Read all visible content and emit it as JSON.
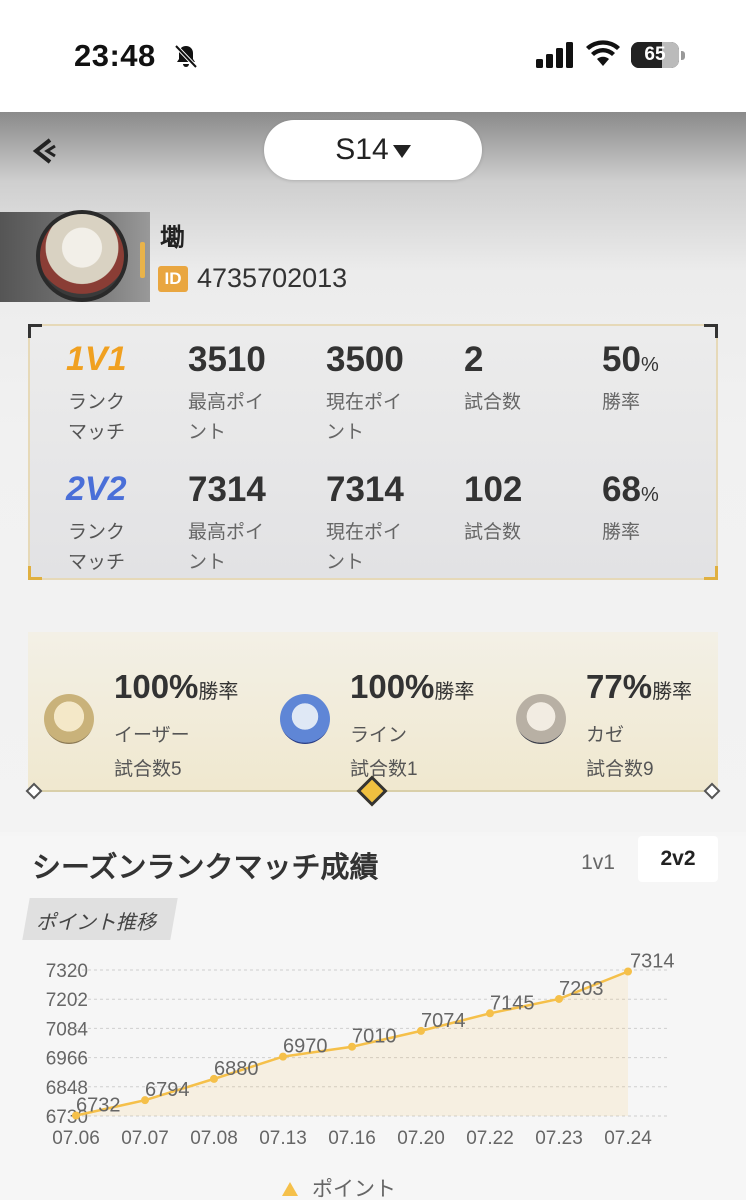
{
  "status_bar": {
    "time": "23:48",
    "battery": "65",
    "battery_level": 0.65
  },
  "header": {
    "season": "S14"
  },
  "profile": {
    "name": "墈",
    "id_badge": "ID",
    "id": "4735702013"
  },
  "ranked": [
    {
      "mode": "1V1",
      "mode_color": "#f0a020",
      "mode_label": "ランク\nマッチ",
      "max_points": "3510",
      "max_points_label": "最高ポイ\nント",
      "current_points": "3500",
      "current_points_label": "現在ポイ\nント",
      "matches": "2",
      "matches_label": "試合数",
      "win_rate": "50",
      "win_rate_unit": "%",
      "win_rate_label": "勝率"
    },
    {
      "mode": "2V2",
      "mode_color": "#4a6fd8",
      "mode_label": "ランク\nマッチ",
      "max_points": "7314",
      "max_points_label": "最高ポイ\nント",
      "current_points": "7314",
      "current_points_label": "現在ポイ\nント",
      "matches": "102",
      "matches_label": "試合数",
      "win_rate": "68",
      "win_rate_unit": "%",
      "win_rate_label": "勝率"
    }
  ],
  "favorites": [
    {
      "rate": "100%",
      "rate_label": "勝率",
      "name": "イーザー",
      "games": "試合数5"
    },
    {
      "rate": "100%",
      "rate_label": "勝率",
      "name": "ライン",
      "games": "試合数1"
    },
    {
      "rate": "77%",
      "rate_label": "勝率",
      "name": "カゼ",
      "games": "試合数9"
    }
  ],
  "results": {
    "title": "シーズンランクマッチ成績",
    "tabs": [
      "1v1",
      "2v2"
    ],
    "active_tab": "2v2",
    "chart_chip": "ポイント推移"
  },
  "chart_data": {
    "type": "line",
    "categories": [
      "07.06",
      "07.07",
      "07.08",
      "07.13",
      "07.16",
      "07.20",
      "07.22",
      "07.23",
      "07.24"
    ],
    "series": [
      {
        "name": "ポイント",
        "values": [
          6732,
          6794,
          6880,
          6970,
          7010,
          7074,
          7145,
          7203,
          7314
        ]
      }
    ],
    "y_ticks": [
      7320,
      7202,
      7084,
      6966,
      6848,
      6730
    ],
    "ylim": [
      6730,
      7320
    ],
    "grid": true,
    "legend": "bottom",
    "color": "#f5c04a"
  }
}
